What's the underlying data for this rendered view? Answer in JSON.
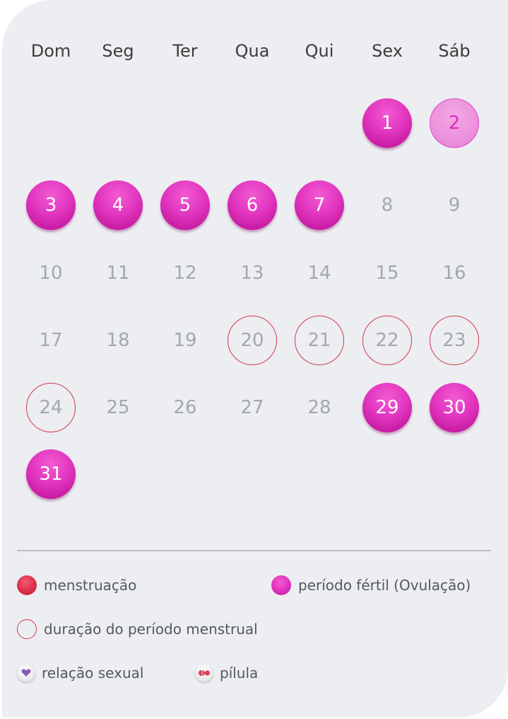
{
  "weekdays": [
    "Dom",
    "Seg",
    "Ter",
    "Qua",
    "Qui",
    "Sex",
    "Sáb"
  ],
  "calendar": {
    "days": [
      {
        "label": "1",
        "state": "fertile"
      },
      {
        "label": "2",
        "state": "fertile-light"
      },
      {
        "label": "3",
        "state": "fertile"
      },
      {
        "label": "4",
        "state": "fertile"
      },
      {
        "label": "5",
        "state": "fertile"
      },
      {
        "label": "6",
        "state": "fertile"
      },
      {
        "label": "7",
        "state": "fertile"
      },
      {
        "label": "8",
        "state": "normal"
      },
      {
        "label": "9",
        "state": "normal"
      },
      {
        "label": "10",
        "state": "normal"
      },
      {
        "label": "11",
        "state": "normal"
      },
      {
        "label": "12",
        "state": "normal"
      },
      {
        "label": "13",
        "state": "normal"
      },
      {
        "label": "14",
        "state": "normal"
      },
      {
        "label": "15",
        "state": "normal"
      },
      {
        "label": "16",
        "state": "normal"
      },
      {
        "label": "17",
        "state": "normal"
      },
      {
        "label": "18",
        "state": "normal"
      },
      {
        "label": "19",
        "state": "normal"
      },
      {
        "label": "20",
        "state": "period"
      },
      {
        "label": "21",
        "state": "period"
      },
      {
        "label": "22",
        "state": "period"
      },
      {
        "label": "23",
        "state": "period"
      },
      {
        "label": "24",
        "state": "period"
      },
      {
        "label": "25",
        "state": "normal"
      },
      {
        "label": "26",
        "state": "normal"
      },
      {
        "label": "27",
        "state": "normal"
      },
      {
        "label": "28",
        "state": "normal"
      },
      {
        "label": "29",
        "state": "fertile"
      },
      {
        "label": "30",
        "state": "fertile"
      },
      {
        "label": "31",
        "state": "fertile"
      }
    ]
  },
  "legend": {
    "menstruation": "menstruação",
    "fertile": "período fértil (Ovulação)",
    "duration": "duração do período menstrual",
    "sex": "relação sexual",
    "pill": "pílula"
  },
  "colors": {
    "fertile": "#e236c0",
    "menstruation": "#dc2e4b",
    "card_background": "#eceef1"
  },
  "icons": {
    "sex": "heart-icon",
    "pill": "pill-icon"
  }
}
